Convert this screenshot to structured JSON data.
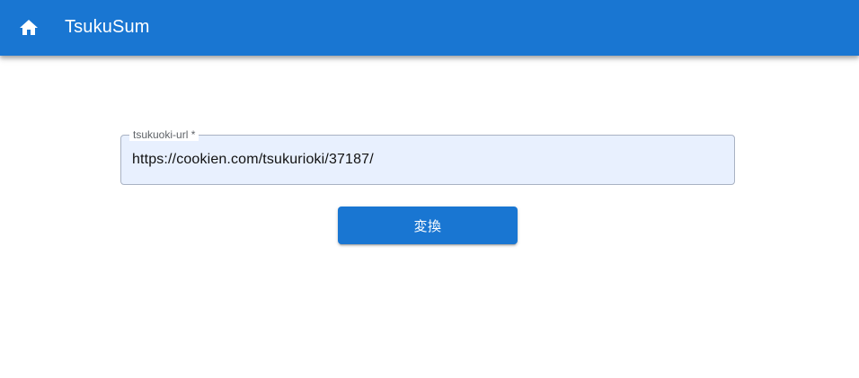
{
  "app_bar": {
    "title": "TsukuSum",
    "home_icon": "home-icon",
    "background_color": "#1976d2"
  },
  "form": {
    "url_field": {
      "label": "tsukuoki-url *",
      "value": "https://cookien.com/tsukurioki/37187/"
    },
    "convert_button": {
      "label": "変換",
      "color": "#1976d2"
    }
  }
}
